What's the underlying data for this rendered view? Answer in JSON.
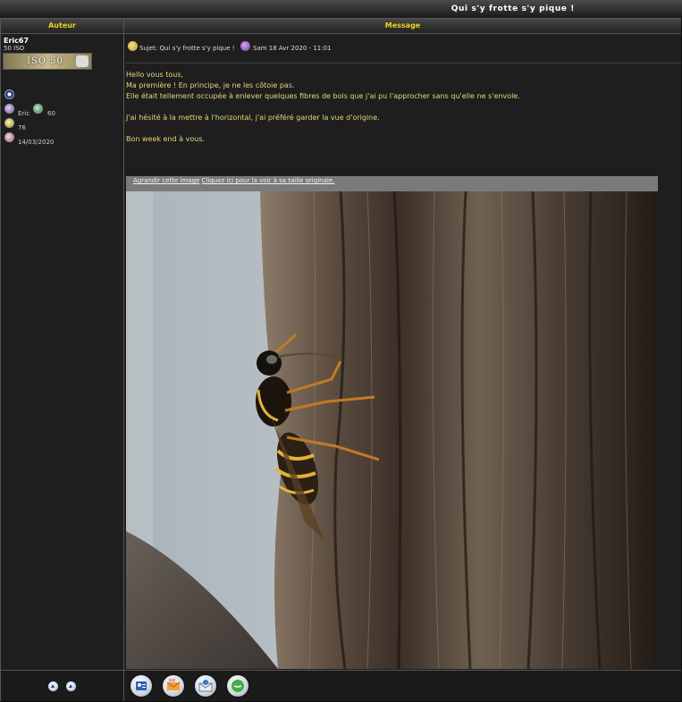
{
  "topic_title": "Qui s'y frotte s'y pique !",
  "headers": {
    "author": "Auteur",
    "message": "Message"
  },
  "author": {
    "username": "Eric67",
    "rank": "50 ISO",
    "rank_badge_text": "ISO 50",
    "first_name": "Eric",
    "points": "60",
    "posts": "76",
    "registered": "14/03/2020"
  },
  "post": {
    "subject": "Sujet: Qui s'y frotte s'y pique !",
    "date": "Sam 18 Avr 2020 - 11:01",
    "lines": [
      "Hello vous tous,",
      "Ma première ! En principe, je ne les côtoie pas.",
      "Elle était tellement occupée à enlever quelques fibres de bois que j'ai pu l'approcher sans qu'elle ne s'envole.",
      "",
      "J'ai hésité à la mettre à l'horizontal, j'ai préféré garder la vue d'origine.",
      "",
      "Bon week end à vous."
    ],
    "image_bar": {
      "prefix": "Agrandir cette image",
      "link": "Cliquez ici pour la voir à sa taille originale."
    }
  },
  "footer": {
    "arrows": [
      "arrow-up-icon",
      "arrow-down-icon"
    ],
    "buttons": [
      "profile-icon",
      "private-message-icon",
      "email-icon",
      "chat-icon"
    ]
  },
  "colors": {
    "accent": "#e8d41a",
    "text_body": "#e6d77a",
    "background": "#1f1e1f"
  }
}
